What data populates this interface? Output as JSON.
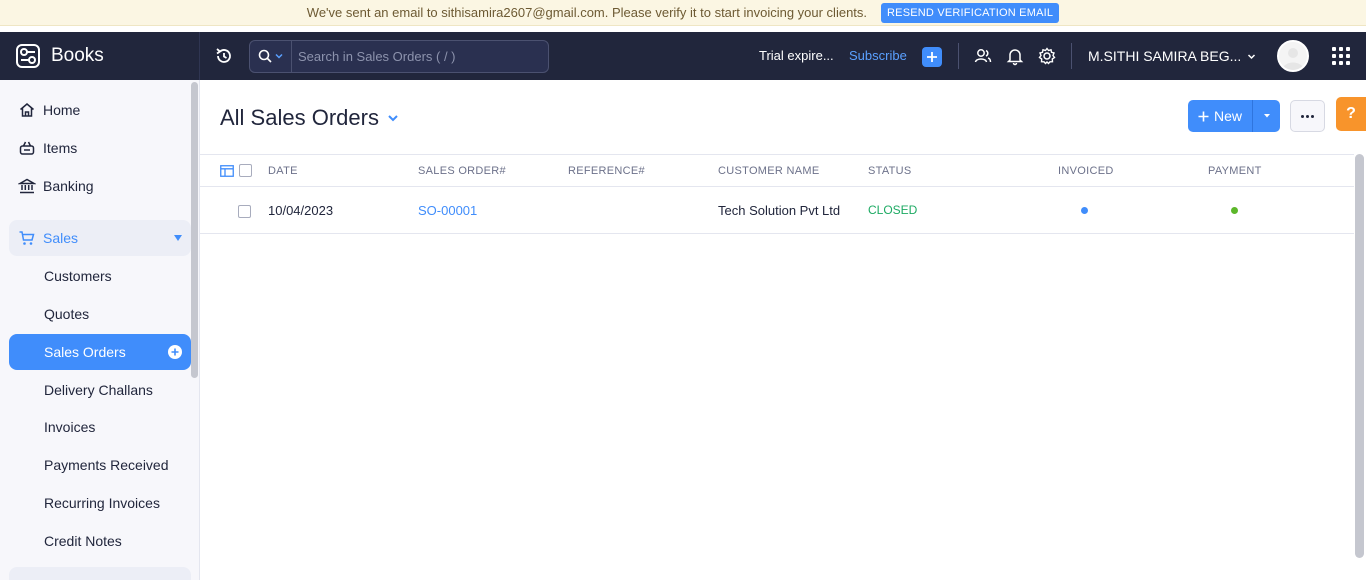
{
  "banner": {
    "text": "We've sent an email to sithisamira2607@gmail.com. Please verify it to start invoicing your clients.",
    "button": "RESEND VERIFICATION EMAIL"
  },
  "topbar": {
    "brand": "Books",
    "search_placeholder": "Search in Sales Orders ( / )",
    "trial": "Trial expire...",
    "subscribe": "Subscribe",
    "org_name": "M.SITHI SAMIRA BEG...",
    "colors": {
      "bg": "#21263c",
      "accent": "#408dfb"
    }
  },
  "sidebar": {
    "items": [
      {
        "label": "Home",
        "icon": "home-icon"
      },
      {
        "label": "Items",
        "icon": "basket-icon"
      },
      {
        "label": "Banking",
        "icon": "bank-icon"
      }
    ],
    "sales": {
      "label": "Sales",
      "icon": "cart-icon",
      "subitems": [
        "Customers",
        "Quotes",
        "Sales Orders",
        "Delivery Challans",
        "Invoices",
        "Payments Received",
        "Recurring Invoices",
        "Credit Notes"
      ],
      "active": "Sales Orders"
    }
  },
  "main": {
    "title": "All Sales Orders",
    "new_label": "New",
    "columns": [
      "DATE",
      "SALES ORDER#",
      "REFERENCE#",
      "CUSTOMER NAME",
      "STATUS",
      "INVOICED",
      "PAYMENT"
    ],
    "rows": [
      {
        "date": "10/04/2023",
        "order": "SO-00001",
        "reference": "",
        "customer": "Tech Solution Pvt Ltd",
        "status": "CLOSED",
        "invoiced_color": "#408dfb",
        "payment_color": "#5cb72a"
      }
    ]
  }
}
